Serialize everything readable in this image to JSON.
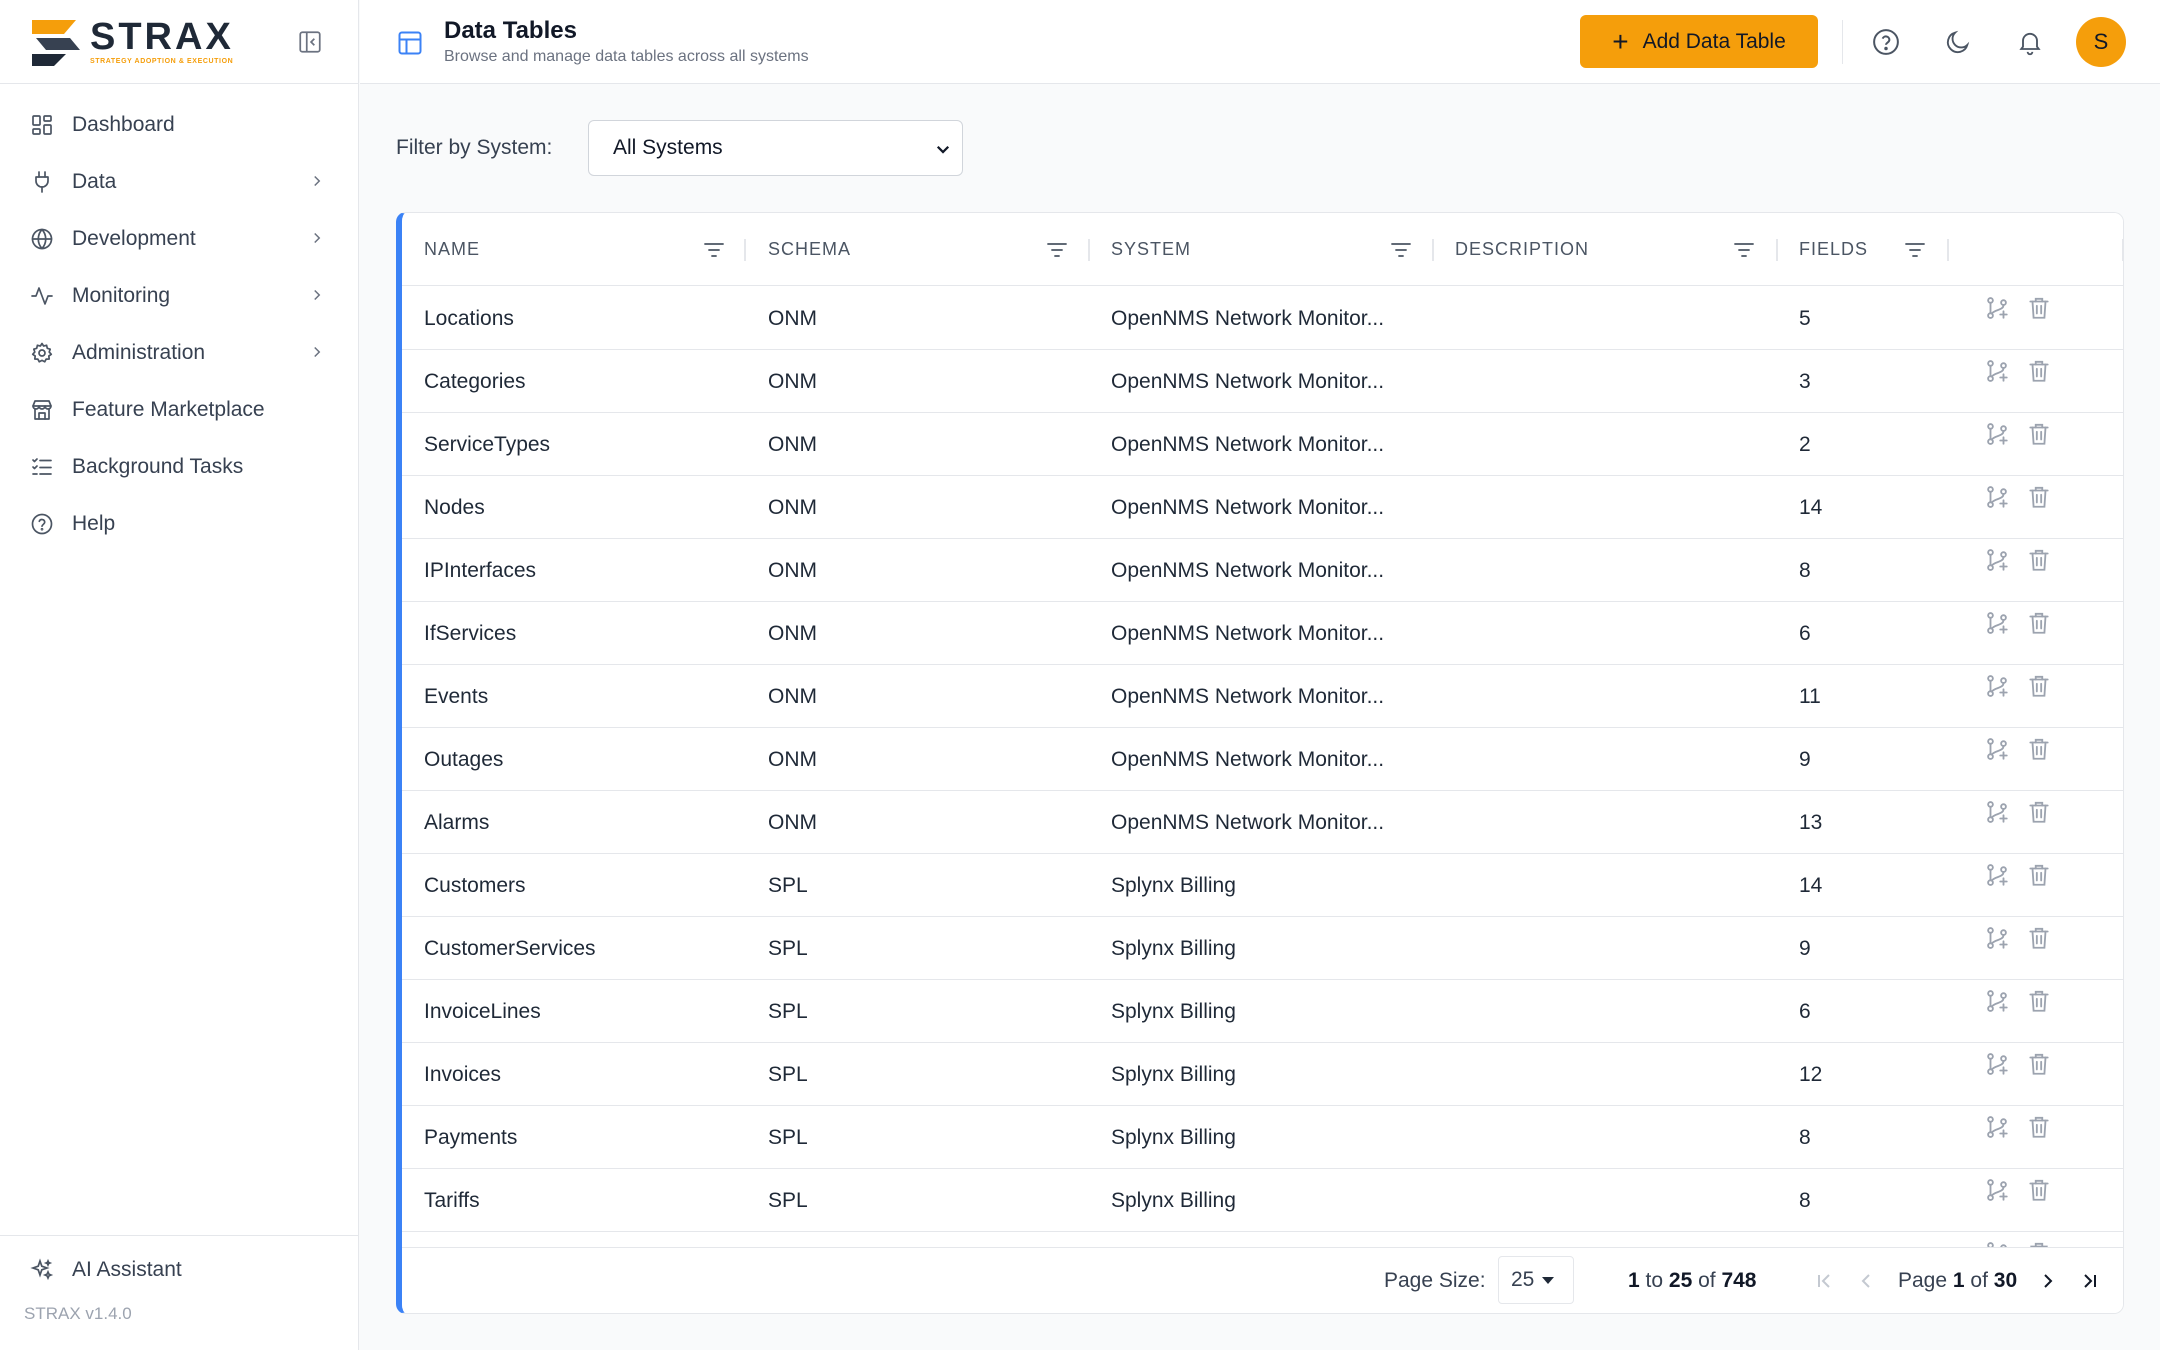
{
  "brand": {
    "name": "STRAX",
    "tagline": "STRATEGY ADOPTION & EXECUTION",
    "version": "STRAX v1.4.0"
  },
  "sidebar": {
    "items": [
      {
        "label": "Dashboard",
        "icon": "dashboard-icon",
        "has_children": false
      },
      {
        "label": "Data",
        "icon": "plug-icon",
        "has_children": true
      },
      {
        "label": "Development",
        "icon": "globe-icon",
        "has_children": true
      },
      {
        "label": "Monitoring",
        "icon": "activity-icon",
        "has_children": true
      },
      {
        "label": "Administration",
        "icon": "gear-icon",
        "has_children": true
      },
      {
        "label": "Feature Marketplace",
        "icon": "store-icon",
        "has_children": false
      },
      {
        "label": "Background Tasks",
        "icon": "list-check-icon",
        "has_children": false
      },
      {
        "label": "Help",
        "icon": "help-circle-icon",
        "has_children": false
      }
    ],
    "bottom_item": {
      "label": "AI Assistant",
      "icon": "sparkles-icon"
    }
  },
  "header": {
    "title": "Data Tables",
    "subtitle": "Browse and manage data tables across all systems",
    "add_button": "Add Data Table",
    "avatar_initial": "S"
  },
  "filter": {
    "label": "Filter by System:",
    "selected": "All Systems"
  },
  "table": {
    "columns": [
      "NAME",
      "SCHEMA",
      "SYSTEM",
      "DESCRIPTION",
      "FIELDS"
    ],
    "rows": [
      {
        "name": "Locations",
        "schema": "ONM",
        "system": "OpenNMS Network Monitor...",
        "description": "",
        "fields": "5"
      },
      {
        "name": "Categories",
        "schema": "ONM",
        "system": "OpenNMS Network Monitor...",
        "description": "",
        "fields": "3"
      },
      {
        "name": "ServiceTypes",
        "schema": "ONM",
        "system": "OpenNMS Network Monitor...",
        "description": "",
        "fields": "2"
      },
      {
        "name": "Nodes",
        "schema": "ONM",
        "system": "OpenNMS Network Monitor...",
        "description": "",
        "fields": "14"
      },
      {
        "name": "IPInterfaces",
        "schema": "ONM",
        "system": "OpenNMS Network Monitor...",
        "description": "",
        "fields": "8"
      },
      {
        "name": "IfServices",
        "schema": "ONM",
        "system": "OpenNMS Network Monitor...",
        "description": "",
        "fields": "6"
      },
      {
        "name": "Events",
        "schema": "ONM",
        "system": "OpenNMS Network Monitor...",
        "description": "",
        "fields": "11"
      },
      {
        "name": "Outages",
        "schema": "ONM",
        "system": "OpenNMS Network Monitor...",
        "description": "",
        "fields": "9"
      },
      {
        "name": "Alarms",
        "schema": "ONM",
        "system": "OpenNMS Network Monitor...",
        "description": "",
        "fields": "13"
      },
      {
        "name": "Customers",
        "schema": "SPL",
        "system": "Splynx Billing",
        "description": "",
        "fields": "14"
      },
      {
        "name": "CustomerServices",
        "schema": "SPL",
        "system": "Splynx Billing",
        "description": "",
        "fields": "9"
      },
      {
        "name": "InvoiceLines",
        "schema": "SPL",
        "system": "Splynx Billing",
        "description": "",
        "fields": "6"
      },
      {
        "name": "Invoices",
        "schema": "SPL",
        "system": "Splynx Billing",
        "description": "",
        "fields": "12"
      },
      {
        "name": "Payments",
        "schema": "SPL",
        "system": "Splynx Billing",
        "description": "",
        "fields": "8"
      },
      {
        "name": "Tariffs",
        "schema": "SPL",
        "system": "Splynx Billing",
        "description": "",
        "fields": "8"
      }
    ]
  },
  "pagination": {
    "page_size_label": "Page Size:",
    "page_size": "25",
    "range_start": "1",
    "range_to": "to",
    "range_end": "25",
    "range_of": "of",
    "total": "748",
    "page_word": "Page",
    "current_page": "1",
    "page_of": "of",
    "total_pages": "30"
  },
  "colors": {
    "accent": "#f59e0b",
    "grid_border": "#3b82f6"
  }
}
